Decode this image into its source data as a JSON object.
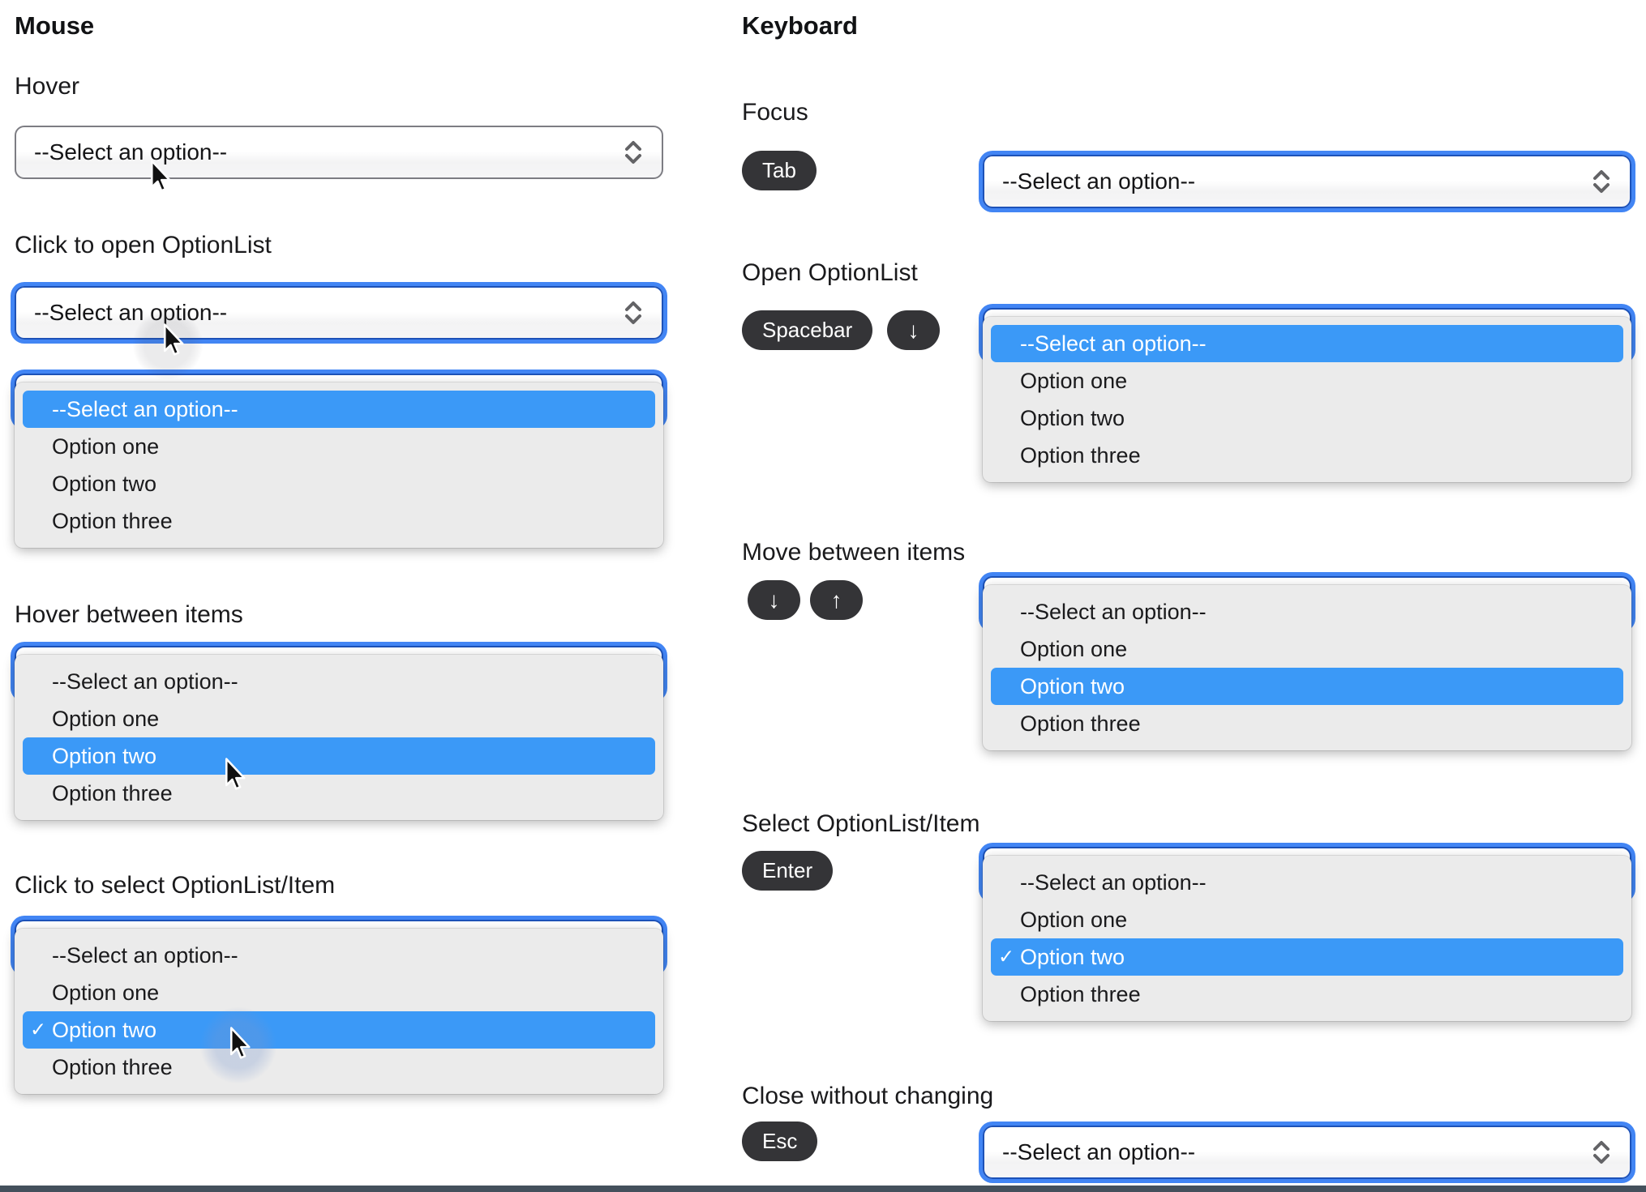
{
  "mouse": {
    "title": "Mouse",
    "sections": [
      {
        "label": "Hover"
      },
      {
        "label": "Click to open OptionList"
      },
      {
        "label": "Hover between items"
      },
      {
        "label": "Click to select OptionList/Item"
      }
    ]
  },
  "keyboard": {
    "title": "Keyboard",
    "sections": [
      {
        "label": "Focus",
        "keys": [
          "Tab"
        ]
      },
      {
        "label": "Open OptionList",
        "keys": [
          "Spacebar",
          "↓"
        ]
      },
      {
        "label": "Move between items",
        "keys": [
          "↓",
          "↑"
        ]
      },
      {
        "label": "Select OptionList/Item",
        "keys": [
          "Enter"
        ]
      },
      {
        "label": "Close without changing",
        "keys": [
          "Esc"
        ]
      }
    ]
  },
  "select": {
    "placeholder": "--Select an option--",
    "options": [
      "--Select an option--",
      "Option one",
      "Option two",
      "Option three"
    ],
    "selected_option": "Option two",
    "checkmark": "✓"
  },
  "colors": {
    "highlight_blue": "#3b99f7",
    "focus_ring_blue": "#4285f4",
    "focus_inner_border": "#1d52b8",
    "panel_gray": "#ebebeb",
    "key_pill_dark": "#343437",
    "bottom_divider": "#44505c"
  }
}
